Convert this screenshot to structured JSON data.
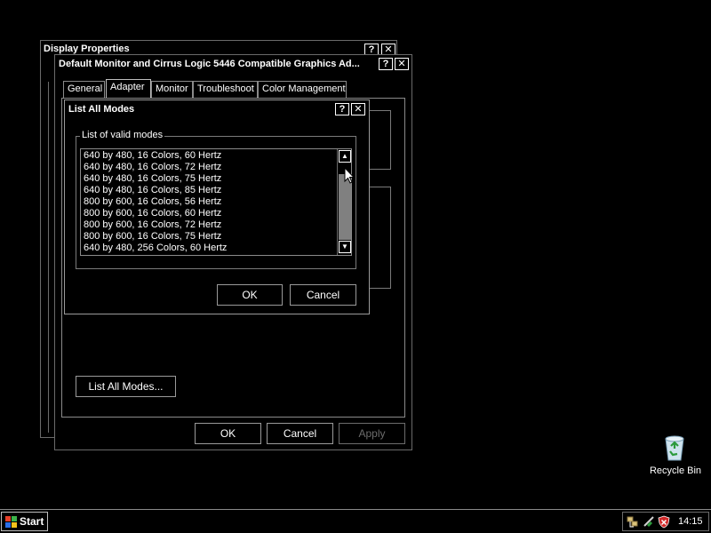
{
  "display_properties": {
    "title": "Display Properties",
    "help": "?",
    "close": "✕"
  },
  "adapter_dialog": {
    "title": "Default Monitor and Cirrus Logic 5446 Compatible Graphics Ad...",
    "help": "?",
    "close": "✕",
    "tabs": [
      {
        "label": "General"
      },
      {
        "label": "Adapter"
      },
      {
        "label": "Monitor"
      },
      {
        "label": "Troubleshoot"
      },
      {
        "label": "Color Management"
      }
    ],
    "active_tab": "Adapter",
    "list_all_modes_button": "List All Modes...",
    "ok": "OK",
    "cancel": "Cancel",
    "apply": "Apply"
  },
  "list_modes_dialog": {
    "title": "List All Modes",
    "help": "?",
    "close": "✕",
    "group_label": "List of valid modes",
    "modes": [
      "640 by 480, 16 Colors, 60 Hertz",
      "640 by 480, 16 Colors, 72 Hertz",
      "640 by 480, 16 Colors, 75 Hertz",
      "640 by 480, 16 Colors, 85 Hertz",
      "800 by 600, 16 Colors, 56 Hertz",
      "800 by 600, 16 Colors, 60 Hertz",
      "800 by 600, 16 Colors, 72 Hertz",
      "800 by 600, 16 Colors, 75 Hertz",
      "640 by 480, 256 Colors, 60 Hertz"
    ],
    "scroll_up": "▲",
    "scroll_down": "▼",
    "ok": "OK",
    "cancel": "Cancel"
  },
  "desktop": {
    "recycle_bin_label": "Recycle Bin"
  },
  "taskbar": {
    "start_label": "Start",
    "clock": "14:15"
  },
  "colors": {
    "background": "#000000",
    "border": "#6a6a6a",
    "text": "#ffffff",
    "disabled_text": "#6c6c6c",
    "scroll_thumb": "#808080"
  },
  "icons": [
    "windows-logo-icon",
    "recycle-bin-icon",
    "network-icon",
    "security-shield-icon",
    "mouse-cursor-icon"
  ]
}
